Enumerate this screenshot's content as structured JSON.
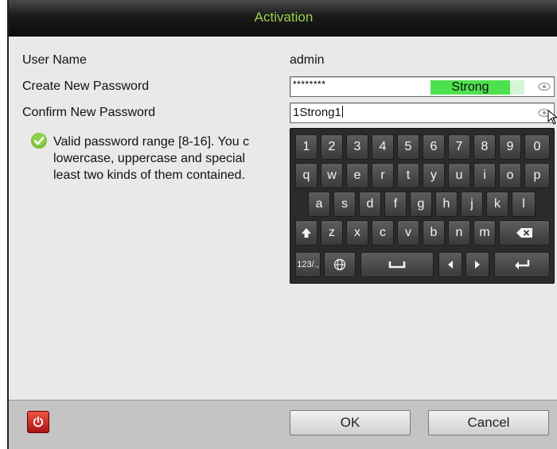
{
  "dialog": {
    "title": "Activation",
    "title_color": "#9bd14a"
  },
  "form": {
    "user_name_label": "User Name",
    "user_name_value": "admin",
    "new_password_label": "Create New Password",
    "new_password_value": "********",
    "strength_label": "Strong",
    "confirm_password_label": "Confirm New Password",
    "confirm_password_value": "1Strong1"
  },
  "hint": {
    "lines": [
      "Valid password range [8-16]. You c",
      "lowercase, uppercase and special",
      "least two kinds of them contained."
    ]
  },
  "keyboard": {
    "row1": [
      "1",
      "2",
      "3",
      "4",
      "5",
      "6",
      "7",
      "8",
      "9",
      "0"
    ],
    "row2": [
      "q",
      "w",
      "e",
      "r",
      "t",
      "y",
      "u",
      "i",
      "o",
      "p"
    ],
    "row3": [
      "a",
      "s",
      "d",
      "f",
      "g",
      "h",
      "j",
      "k",
      "l"
    ],
    "row4": [
      "z",
      "x",
      "c",
      "v",
      "b",
      "n",
      "m"
    ],
    "mode_key": "123/.,"
  },
  "buttons": {
    "ok": "OK",
    "cancel": "Cancel"
  },
  "colors": {
    "strength_bar": "#4ee14f",
    "power_button": "#c62a1a",
    "valid_check": "#7cc23a"
  }
}
